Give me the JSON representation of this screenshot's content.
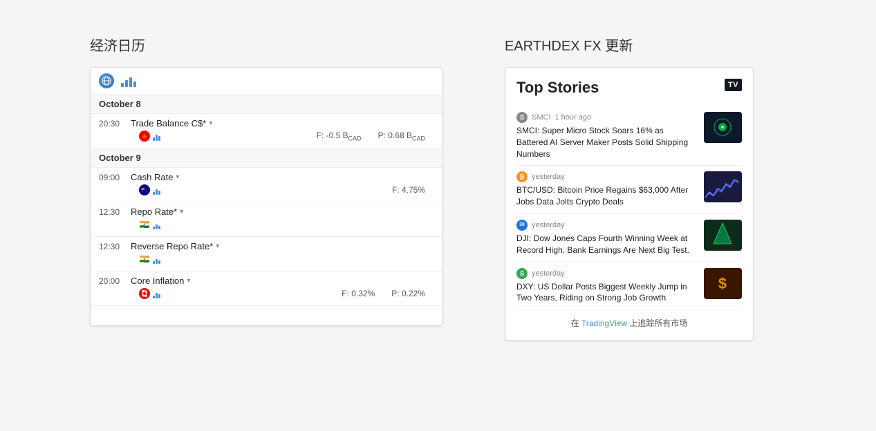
{
  "left": {
    "title": "经济日历",
    "dates": [
      {
        "label": "October 8",
        "events": [
          {
            "time": "20:30",
            "name": "Trade Balance C$*",
            "country": "ca",
            "forecast": "F: -0.5 B",
            "unit": "CAD",
            "previous": "P: 0.68 B",
            "prev_unit": "CAD"
          }
        ]
      },
      {
        "label": "October 9",
        "events": [
          {
            "time": "09:00",
            "name": "Cash Rate",
            "country": "au",
            "forecast": "F: 4.75%",
            "previous": ""
          },
          {
            "time": "12:30",
            "name": "Repo Rate*",
            "country": "in",
            "forecast": "",
            "previous": ""
          },
          {
            "time": "12:30",
            "name": "Reverse Repo Rate*",
            "country": "in",
            "forecast": "",
            "previous": ""
          },
          {
            "time": "20:00",
            "name": "Core Inflation",
            "country": "ca",
            "forecast": "F: 0.32%",
            "previous": "P: 0.22%"
          }
        ]
      }
    ]
  },
  "right": {
    "title": "EARTHDEX FX 更新",
    "widget": {
      "top_stories_label": "Top Stories",
      "items": [
        {
          "source": "SMCI",
          "badge_class": "badge-smci",
          "badge_text": "S",
          "time": "1 hour ago",
          "headline": "SMCI: Super Micro Stock Soars 16% as Battered AI Server Maker Posts Solid Shipping Numbers"
        },
        {
          "source": "B",
          "badge_class": "badge-btc",
          "badge_text": "B",
          "time": "yesterday",
          "headline": "BTC/USD: Bitcoin Price Regains $63,000 After Jobs Data Jolts Crypto Deals"
        },
        {
          "source": "30",
          "badge_class": "badge-30",
          "badge_text": "30",
          "time": "yesterday",
          "headline": "DJI: Dow Jones Caps Fourth Winning Week at Record High. Bank Earnings Are Next Big Test."
        },
        {
          "source": "S",
          "badge_class": "badge-s",
          "badge_text": "S",
          "time": "yesterday",
          "headline": "DXY: US Dollar Posts Biggest Weekly Jump in Two Years, Riding on Strong Job Growth"
        }
      ],
      "footer": "在 TradingView 上追踪所有市场",
      "footer_link": "TradingView"
    }
  }
}
